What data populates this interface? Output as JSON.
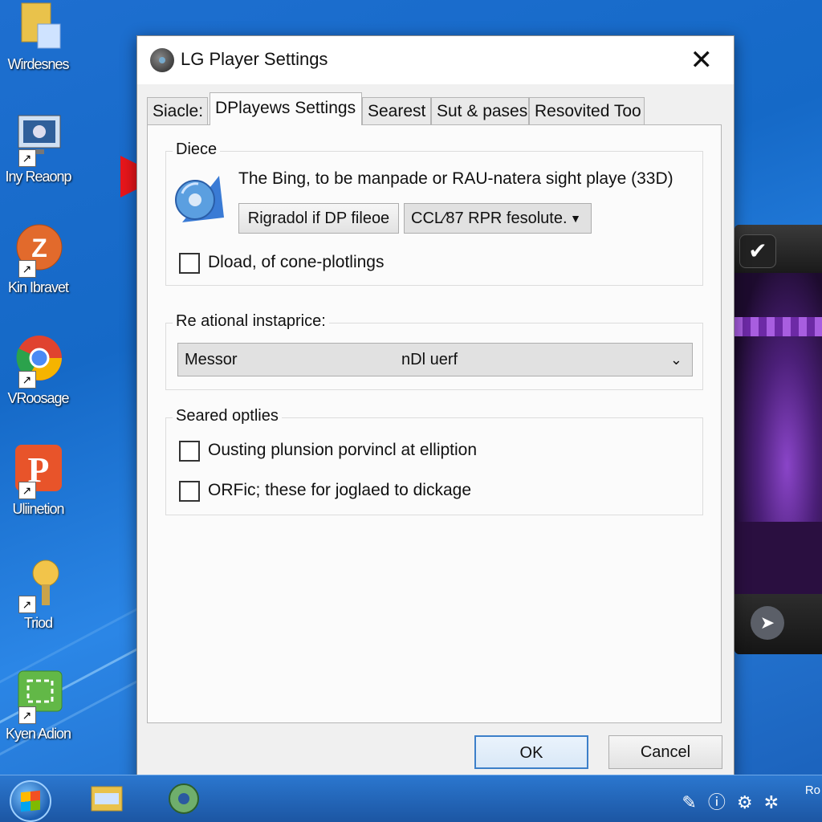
{
  "desktop": {
    "icons": [
      {
        "label": "Wirdesnes",
        "icon": "folder-icon"
      },
      {
        "label": "Iny Reaonp",
        "icon": "monitor-icon"
      },
      {
        "label": "Kin Ibravet",
        "icon": "z-app-icon"
      },
      {
        "label": "VRoosage",
        "icon": "chrome-icon"
      },
      {
        "label": "Uliinetion",
        "icon": "p-app-icon"
      },
      {
        "label": "Triod",
        "icon": "lightbulb-icon"
      },
      {
        "label": "Kyen Adion",
        "icon": "green-app-icon"
      }
    ]
  },
  "dialog": {
    "title": "LG Player Settings",
    "tabs": [
      {
        "label": "Siacle:"
      },
      {
        "label": "DPlayews Settings",
        "active": true
      },
      {
        "label": "Searest"
      },
      {
        "label": "Sut & pases"
      },
      {
        "label": "Resovited Too"
      }
    ],
    "group1": {
      "title": "Diece",
      "description": "The Bing, to be manpade or RAU-natera sight playe (33D)",
      "button_label": "Rigradol if DP fileoe",
      "dropdown_value": "CCL⁄87 RPR fesolute.",
      "checkbox_label": "Dload, of cone-plotlings",
      "checkbox_checked": false
    },
    "group2": {
      "title": "Re ational instaprice:",
      "dropdown_left": "Messor",
      "dropdown_center": "nDl uerf"
    },
    "group3": {
      "title": "Seared optlies",
      "options": [
        {
          "label": "Ousting plunsion porvincl at elliption",
          "checked": false
        },
        {
          "label": "ORFic; these for joglaed to dickage",
          "checked": false
        }
      ]
    },
    "ok_label": "OK",
    "cancel_label": "Cancel"
  },
  "taskbar": {
    "clock": "Ro"
  },
  "colors": {
    "accent": "#3c7fc9",
    "arrow": "#e8161b",
    "desktop": "#1e6fd0"
  }
}
